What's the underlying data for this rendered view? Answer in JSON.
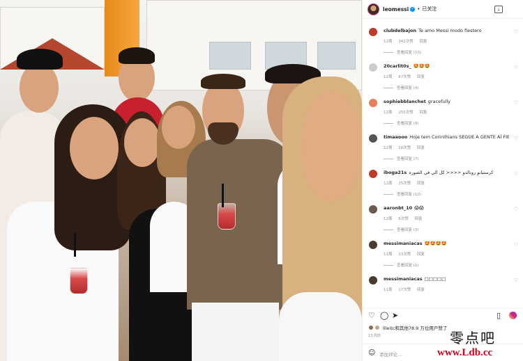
{
  "header": {
    "username": "leomessi",
    "verified_mark": "✓",
    "separator": "•",
    "follow_status": "已关注",
    "more_icon": "download-icon"
  },
  "comments": [
    {
      "username": "clubdelbajon",
      "text": "Te amo Messi modo fiestero",
      "time": "12周",
      "likes": "342次赞",
      "reply": "回复",
      "view_replies": "查看回复 (10)",
      "avatar_color": "#c0392b"
    },
    {
      "username": "20carlit0s_",
      "text": "🤩🤩🤩",
      "time": "12周",
      "likes": "67次赞",
      "reply": "回复",
      "view_replies": "查看回复 (4)",
      "avatar_color": "#cccccc"
    },
    {
      "username": "sophiebblanchet",
      "text": "gracefully",
      "time": "12周",
      "likes": "255次赞",
      "reply": "回复",
      "view_replies": "查看回复 (9)",
      "avatar_color": "#e67e5a"
    },
    {
      "username": "timaaooo",
      "text": "Hoje tem Corinthians SEGUE A GENTE AÍ FIEL",
      "time": "12周",
      "likes": "16次赞",
      "reply": "回复",
      "view_replies": "查看回复 (7)",
      "avatar_color": "#555555"
    },
    {
      "username": "iboga21s",
      "text": "كرستيانو رونالدو <<<< كل الي في الصوره",
      "time": "12周",
      "likes": "25次赞",
      "reply": "回复",
      "view_replies": "查看回复 (10)",
      "avatar_color": "#c0392b"
    },
    {
      "username": "aaronbt_10",
      "text": "😱😱",
      "time": "12周",
      "likes": "6次赞",
      "reply": "回复",
      "view_replies": "查看回复 (3)",
      "avatar_color": "#6b5b4f"
    },
    {
      "username": "messimaniacas",
      "text": "🤩🤩🤩🤩",
      "time": "11周",
      "likes": "23次赞",
      "reply": "回复",
      "view_replies": "查看回复 (1)",
      "avatar_color": "#4a3a30"
    },
    {
      "username": "messimaniacas",
      "text": "□□□□□",
      "time": "11周",
      "likes": "17次赞",
      "reply": "回复",
      "view_replies": "",
      "avatar_color": "#4a3a30"
    }
  ],
  "actions": {
    "like_icon": "heart-icon",
    "comment_icon": "comment-icon",
    "share_icon": "send-icon",
    "save_icon": "bookmark-icon"
  },
  "likes_line": "lileitc和其他78.9 万位用户赞了",
  "time_ago": "13 周前",
  "add_comment": {
    "placeholder": "添加评论..."
  },
  "watermark": {
    "cn": "零点吧",
    "url": "www.Ldb.cc"
  }
}
